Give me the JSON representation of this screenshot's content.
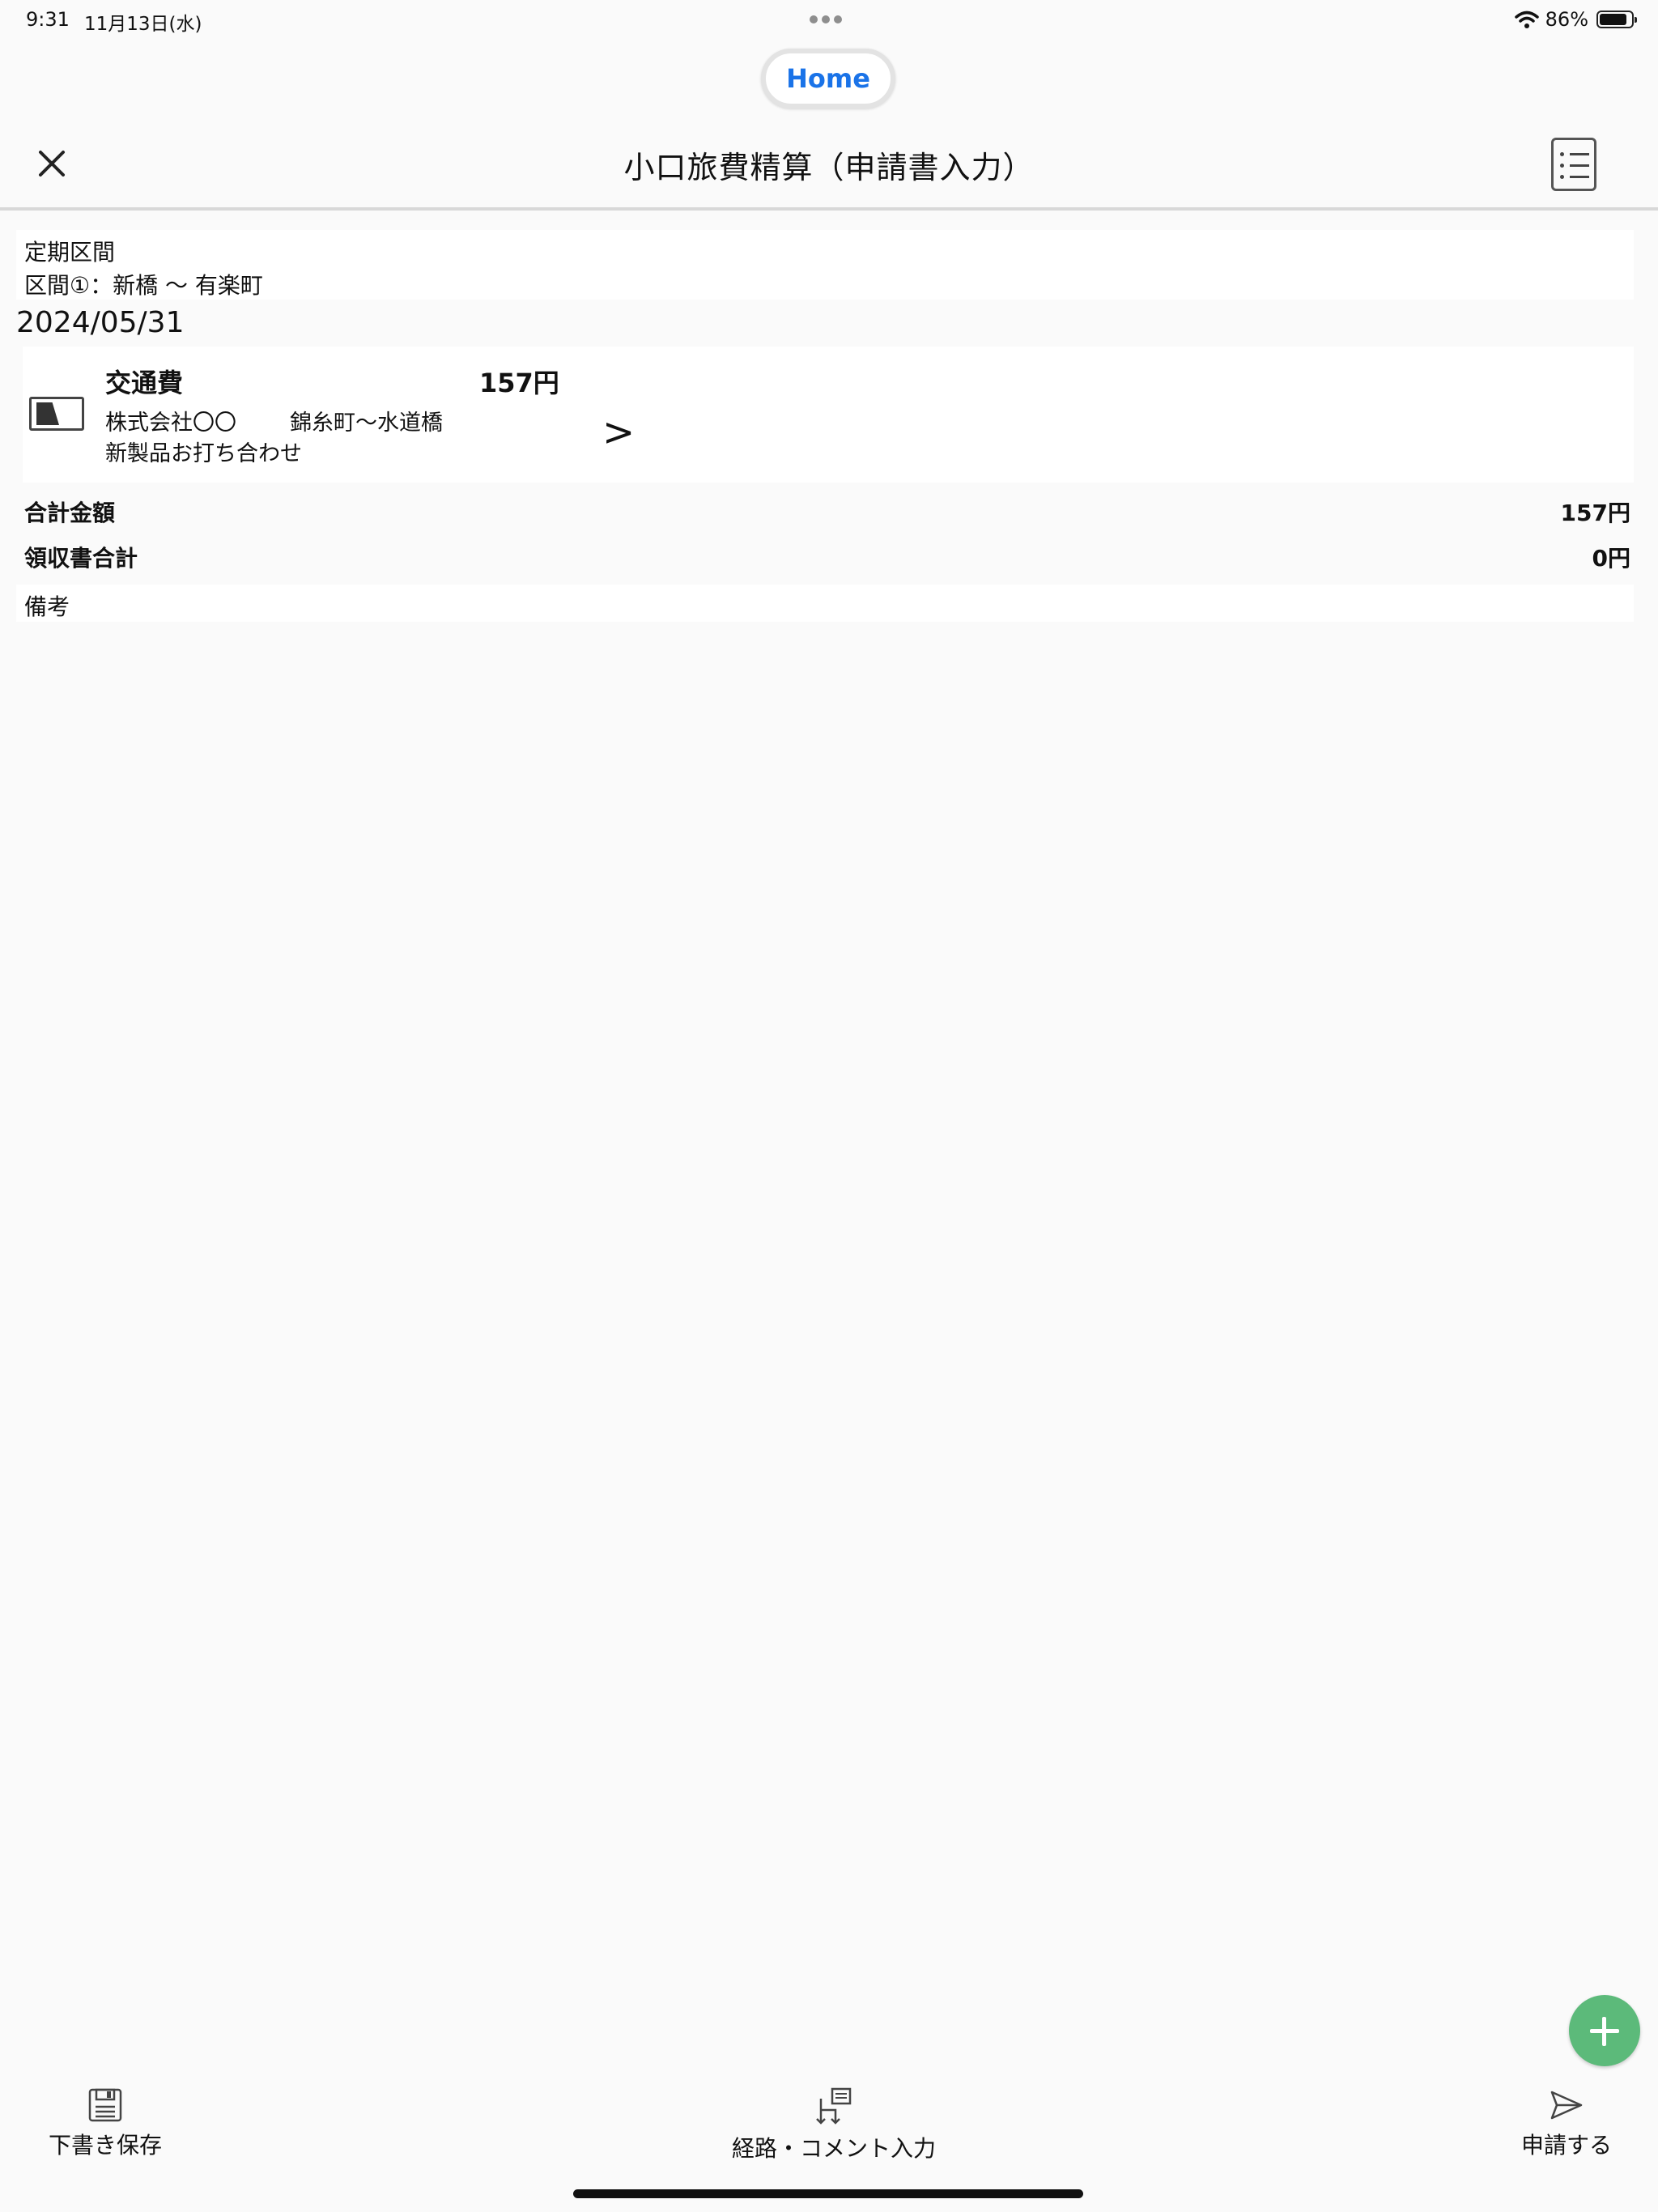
{
  "status_bar": {
    "time": "9:31",
    "date": "11月13日(水)",
    "battery_percent": "86%",
    "battery_level": 0.86
  },
  "home_pill": {
    "label": "Home"
  },
  "nav": {
    "title": "小口旅費精算（申請書入力）",
    "close_icon": "close-icon",
    "menu_icon": "list-icon"
  },
  "commute": {
    "label": "定期区間",
    "route": "区間①：新橋 〜 有楽町"
  },
  "date_heading": "2024/05/31",
  "expense": {
    "category": "交通費",
    "amount": "157円",
    "company": "株式会社〇〇",
    "route": "錦糸町〜水道橋",
    "purpose": "新製品お打ち合わせ",
    "chevron": ">",
    "icon": "receipt-icon"
  },
  "summary": {
    "total_label": "合計金額",
    "total_value": "157円",
    "receipt_label": "領収書合計",
    "receipt_value": "0円",
    "remarks_label": "備考"
  },
  "fab": {
    "icon": "plus-icon",
    "color": "#5cba7a"
  },
  "toolbar": {
    "save_label": "下書き保存",
    "route_label": "経路・コメント入力",
    "submit_label": "申請する"
  },
  "colors": {
    "accent": "#1a73e8",
    "fab": "#5cba7a"
  }
}
